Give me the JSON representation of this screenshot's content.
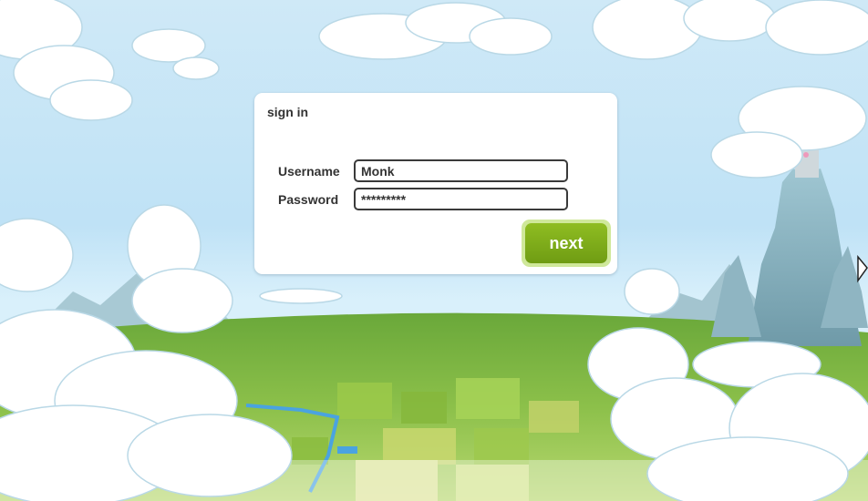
{
  "signin": {
    "title": "sign in",
    "username_label": "Username",
    "username_value": "Monk",
    "password_label": "Password",
    "password_value": "*********",
    "next_label": "next"
  },
  "colors": {
    "sky": "#cfe9f7",
    "field_green": "#7cb43a",
    "button_green": "#7ba91a",
    "button_halo": "#cfe89a",
    "panel_bg": "#ffffff",
    "text_dark": "#333333"
  },
  "icons": [
    "cursor-arrow-icon"
  ]
}
